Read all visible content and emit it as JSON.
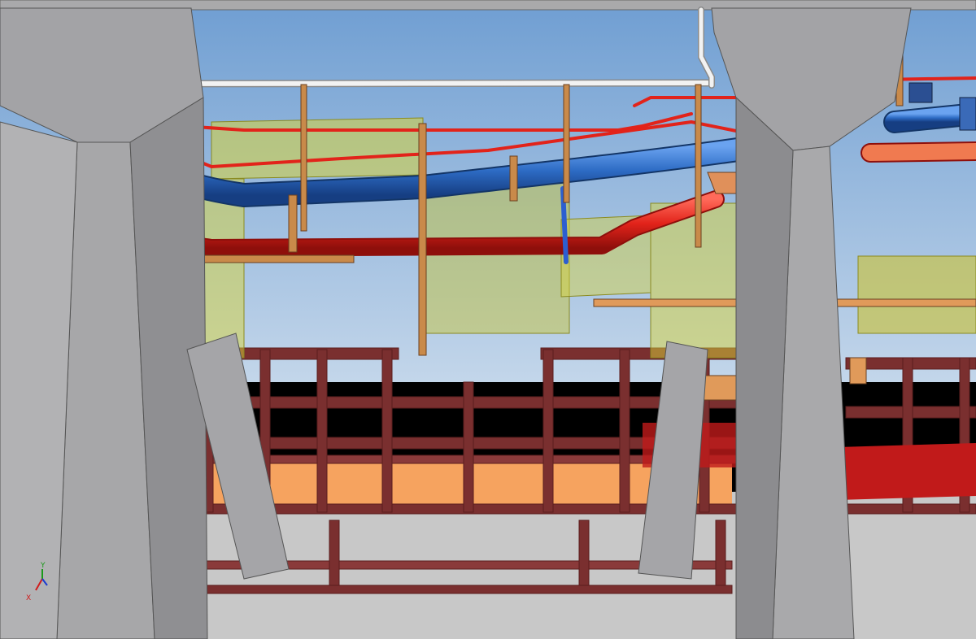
{
  "viewport": {
    "colors": {
      "sky_top": "#6f9ed2",
      "sky_bottom": "#bcd3ea",
      "floor": "#c9c9c9",
      "column": "#a7a7a9",
      "steel": "#7a2f2f",
      "pipe_red": "#e2231a",
      "pipe_blue": "#2d6bc4",
      "pipe_white": "#f2f2f2",
      "duct_yellow": "#d7d33a",
      "support_orange": "#d68b3c",
      "deck_orange": "#f6a35f"
    }
  },
  "axis_triad": {
    "labels": [
      "Y",
      "X"
    ],
    "colors": {
      "y": "#1a9a1a",
      "x": "#d01c1c",
      "z": "#1c3cd0"
    }
  }
}
